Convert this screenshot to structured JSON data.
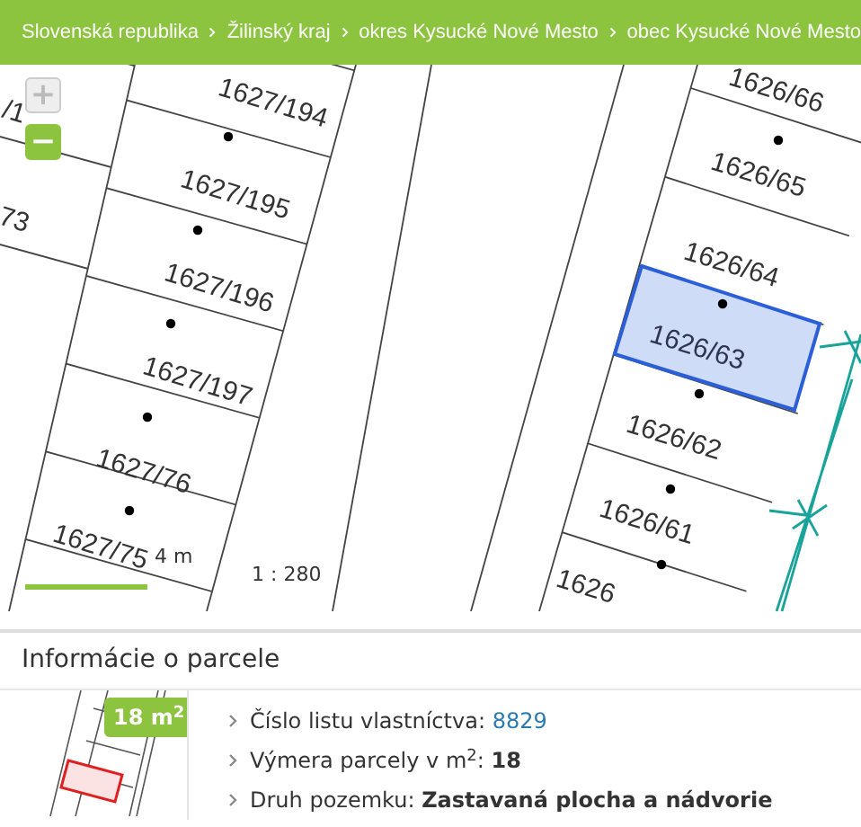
{
  "breadcrumb": [
    {
      "label": "Slovenská republika"
    },
    {
      "label": "Žilinský kraj"
    },
    {
      "label": "okres Kysucké Nové Mesto"
    },
    {
      "label": "obec Kysucké Nové Mesto"
    }
  ],
  "map": {
    "zoom_controls": [
      {
        "label": "+",
        "disabled": true
      },
      {
        "label": "−",
        "disabled": false
      }
    ],
    "parcels": [
      {
        "label": "/1",
        "selected": false
      },
      {
        "label": "73",
        "selected": false
      },
      {
        "label": "1627/194",
        "selected": false
      },
      {
        "label": "1627/195",
        "selected": false
      },
      {
        "label": "1627/196",
        "selected": false
      },
      {
        "label": "1627/197",
        "selected": false
      },
      {
        "label": "1627/76",
        "selected": false
      },
      {
        "label": "1627/75",
        "selected": false
      },
      {
        "label": "1626/66",
        "selected": false
      },
      {
        "label": "1626/65",
        "selected": false
      },
      {
        "label": "1626/64",
        "selected": false
      },
      {
        "label": "1626/63",
        "selected": true
      },
      {
        "label": "1626/62",
        "selected": false
      },
      {
        "label": "1626/61",
        "selected": false
      },
      {
        "label": "1626",
        "selected": false
      }
    ],
    "scale": {
      "distance": "4 m",
      "ratio": "1 : 280"
    }
  },
  "parcel_info": {
    "title": "Informácie o parcele",
    "area_badge": "18 m$^{2}$",
    "items": [
      {
        "label": "Číslo listu vlastníctva:",
        "value": "8829",
        "kind": "link"
      },
      {
        "label": "Výmera parcely v m$^{2}$:",
        "value": "18",
        "kind": "bold"
      },
      {
        "label": "Druh pozemku:",
        "value": "Zastavaná plocha a nádvorie",
        "kind": "bold"
      }
    ]
  }
}
